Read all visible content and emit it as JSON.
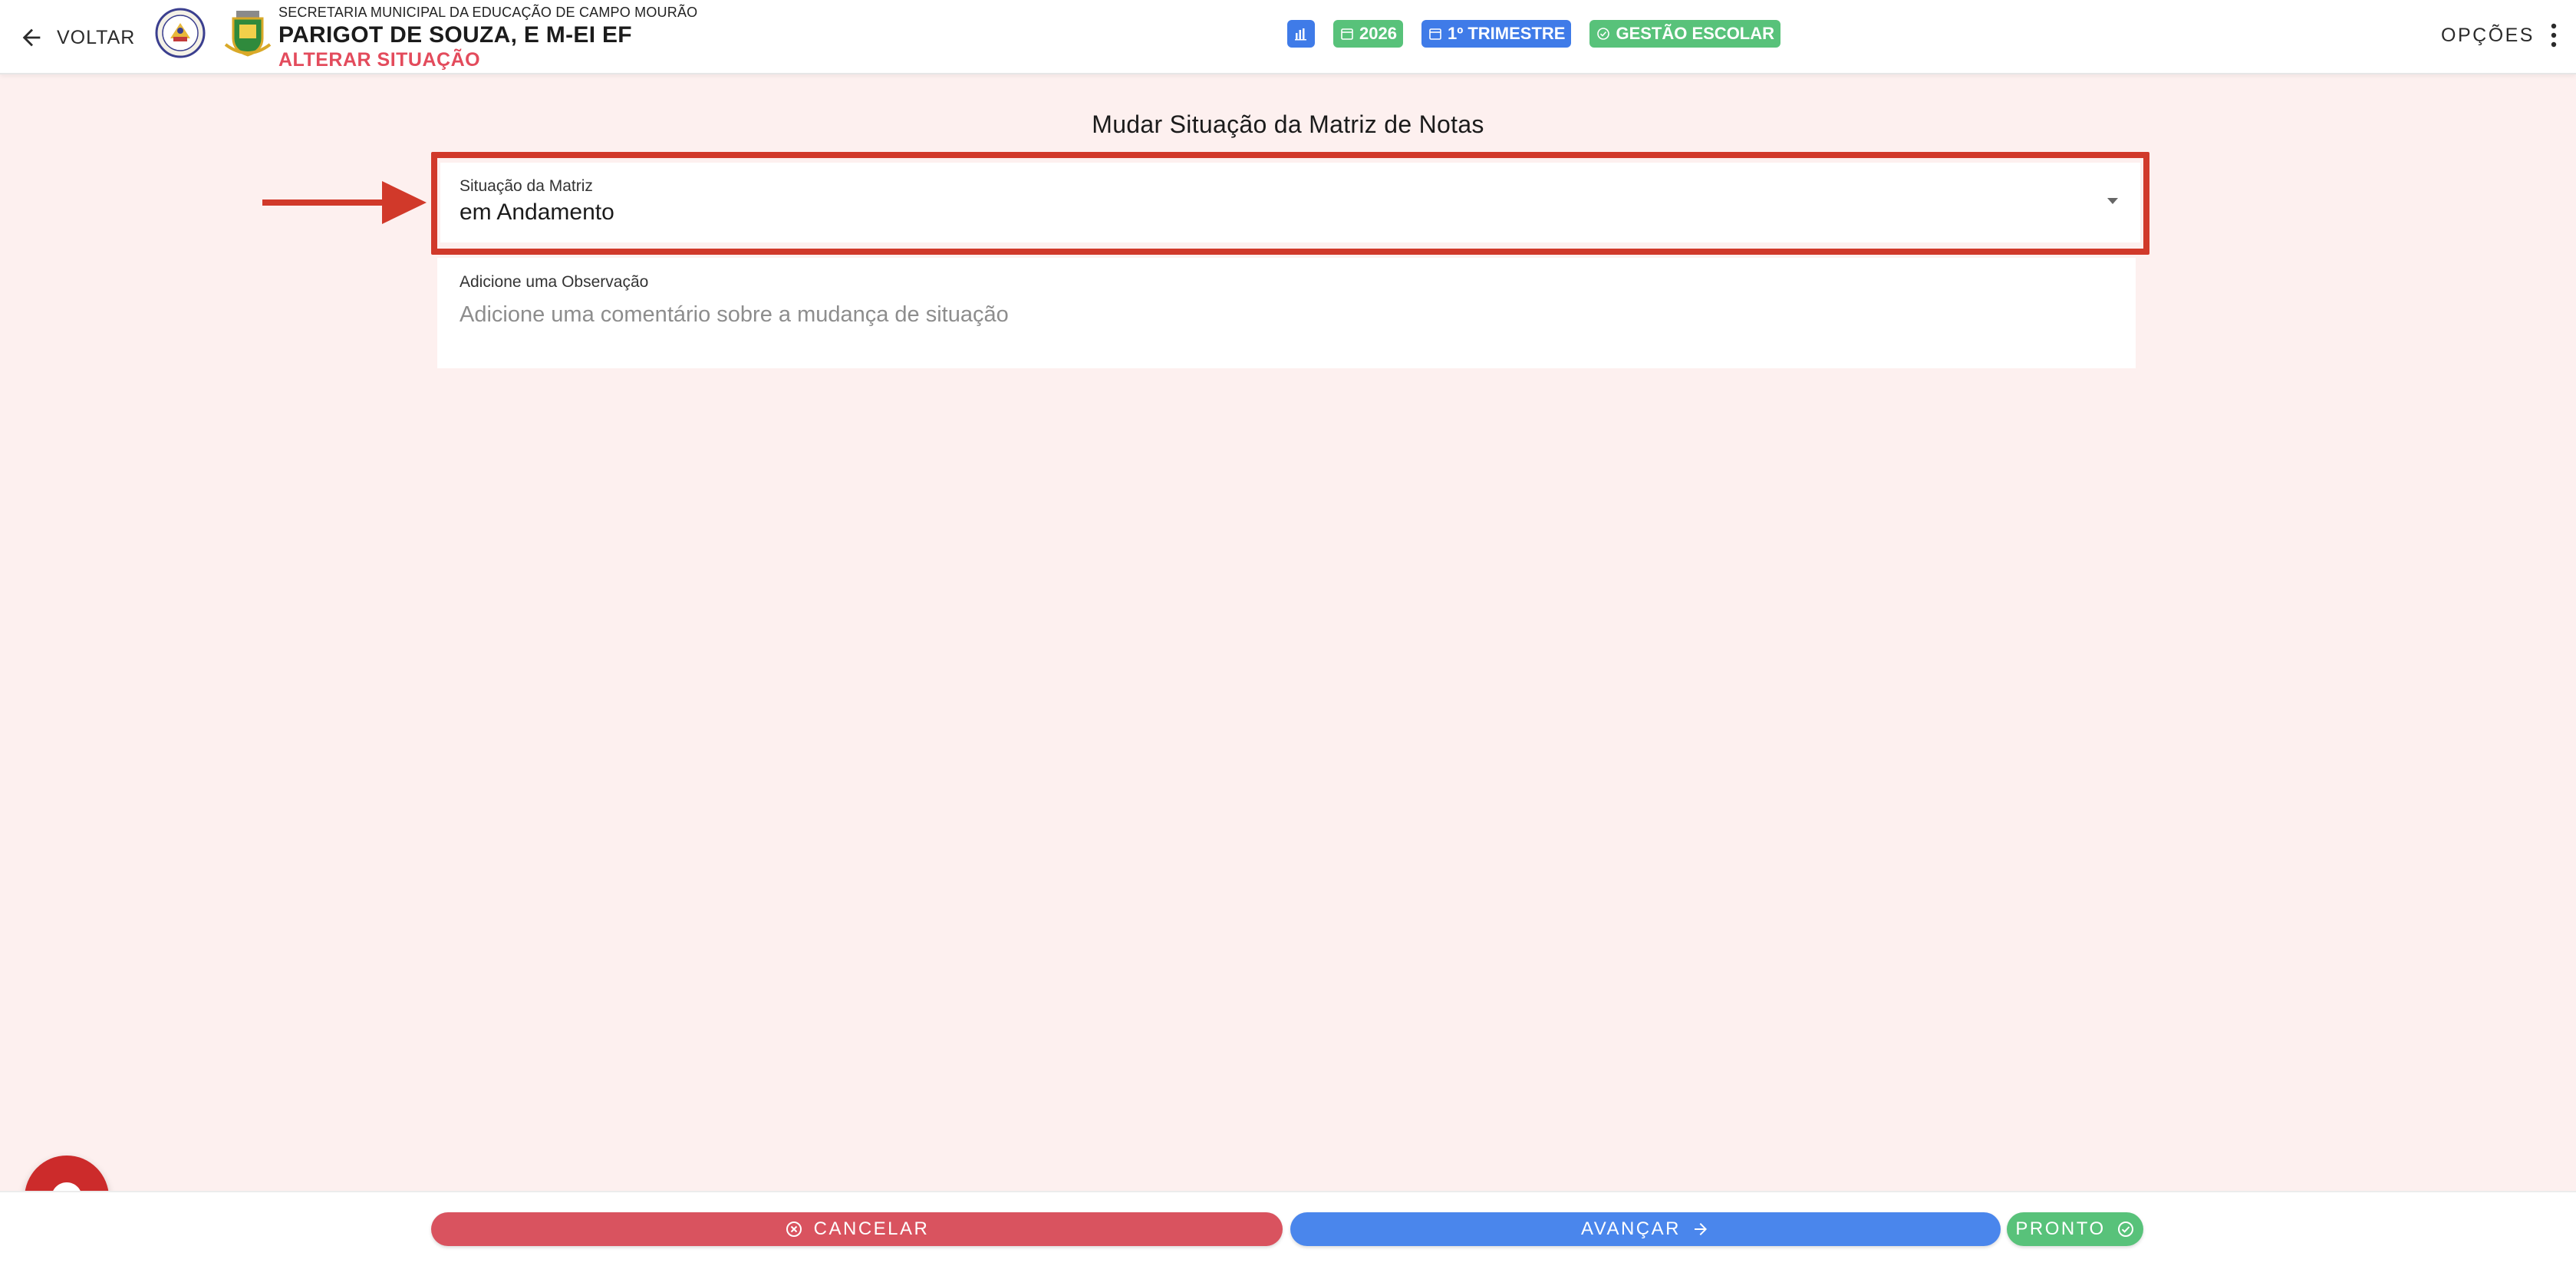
{
  "header": {
    "back_label": "VOLTAR",
    "secretaria": "SECRETARIA MUNICIPAL DA EDUCAÇÃO DE CAMPO MOURÃO",
    "school_name": "PARIGOT DE SOUZA, E M-EI EF",
    "action": "ALTERAR SITUAÇÃO",
    "chips": {
      "year": "2026",
      "period": "1º TRIMESTRE",
      "module": "GESTÃO ESCOLAR"
    },
    "options_label": "OPÇÕES"
  },
  "main": {
    "title": "Mudar Situação da Matriz de Notas",
    "select": {
      "label": "Situação da Matriz",
      "value": "em Andamento"
    },
    "observation": {
      "label": "Adicione uma Observação",
      "placeholder": "Adicione uma comentário sobre a mudança de situação"
    }
  },
  "footer": {
    "cancel_label": "CANCELAR",
    "next_label": "AVANÇAR",
    "done_label": "PRONTO"
  },
  "colors": {
    "accent_red": "#d1392a",
    "action_red": "#e34b5c",
    "blue": "#3f7be8",
    "green": "#58c27a",
    "background": "#fdf0ef"
  }
}
